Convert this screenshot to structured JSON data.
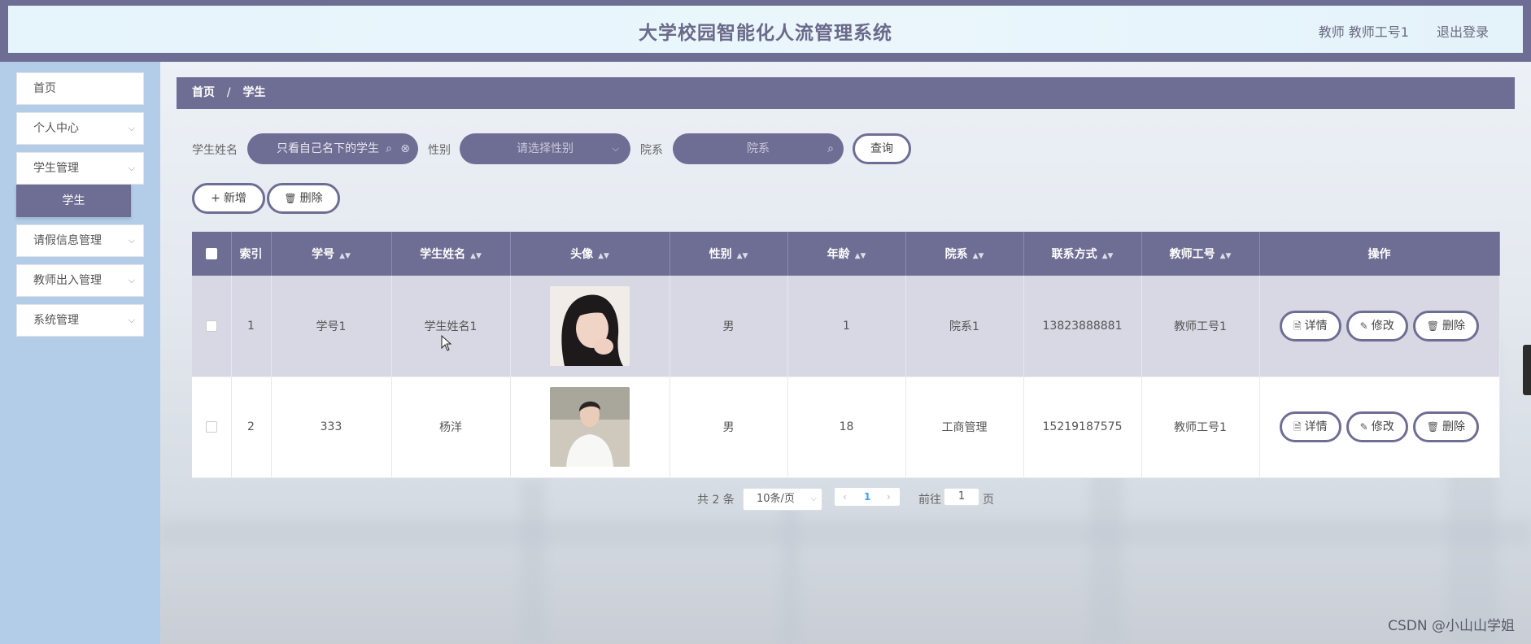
{
  "header": {
    "title": "大学校园智能化人流管理系统",
    "user": "教师 教师工号1",
    "logout": "退出登录"
  },
  "sidebar": {
    "items": [
      {
        "label": "首页",
        "expandable": false
      },
      {
        "label": "个人中心",
        "expandable": true
      },
      {
        "label": "学生管理",
        "expandable": true
      },
      {
        "label": "请假信息管理",
        "expandable": true
      },
      {
        "label": "教师出入管理",
        "expandable": true
      },
      {
        "label": "系统管理",
        "expandable": true
      }
    ],
    "active_sub": "学生"
  },
  "breadcrumb": {
    "home": "首页",
    "sep": "/",
    "current": "学生"
  },
  "search": {
    "name_label": "学生姓名",
    "name_value": "只看自己名下的学生",
    "gender_label": "性别",
    "gender_placeholder": "请选择性别",
    "dept_label": "院系",
    "dept_placeholder": "院系",
    "query_button": "查询"
  },
  "actions": {
    "add": "新增",
    "delete": "删除"
  },
  "table": {
    "columns": [
      "索引",
      "学号",
      "学生姓名",
      "头像",
      "性别",
      "年龄",
      "院系",
      "联系方式",
      "教师工号",
      "操作"
    ],
    "rows": [
      {
        "index": "1",
        "student_no": "学号1",
        "name": "学生姓名1",
        "gender": "男",
        "age": "1",
        "dept": "院系1",
        "phone": "13823888881",
        "teacher_no": "教师工号1"
      },
      {
        "index": "2",
        "student_no": "333",
        "name": "杨洋",
        "gender": "男",
        "age": "18",
        "dept": "工商管理",
        "phone": "15219187575",
        "teacher_no": "教师工号1"
      }
    ],
    "row_buttons": {
      "detail": "详情",
      "edit": "修改",
      "delete": "删除"
    }
  },
  "pagination": {
    "total": "共 2 条",
    "page_size": "10条/页",
    "current_page": "1",
    "goto_label": "前往",
    "goto_value": "1",
    "page_suffix": "页"
  },
  "watermark": "CSDN @小山山学姐",
  "colors": {
    "primary": "#6e6e94",
    "sidebar": "#b3cde8",
    "header_bg": "#e6f4fb",
    "active_page": "#409eff"
  }
}
